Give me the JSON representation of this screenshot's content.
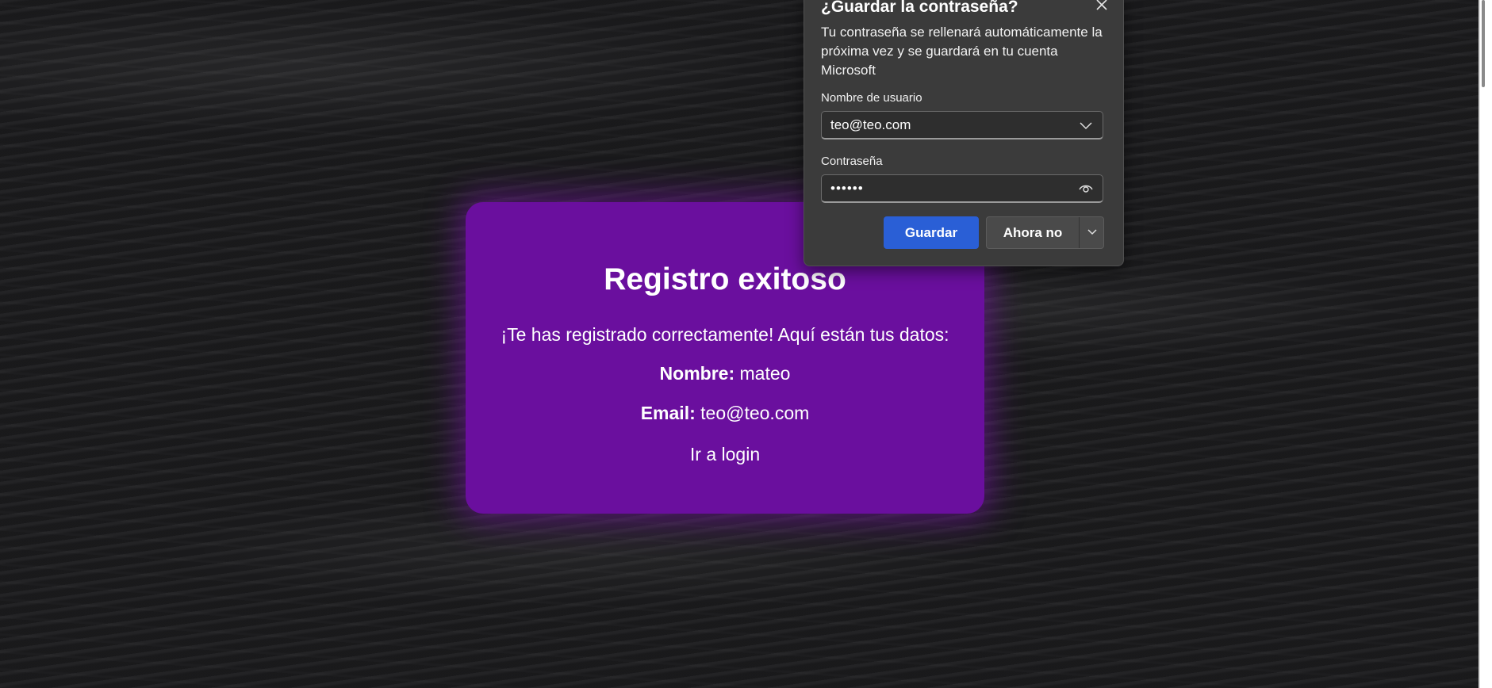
{
  "card": {
    "title": "Registro exitoso",
    "message": "¡Te has registrado correctamente! Aquí están tus datos:",
    "name_label": "Nombre:",
    "name_value": "mateo",
    "email_label": "Email:",
    "email_value": "teo@teo.com",
    "login_link": "Ir a login",
    "background_color": "#6a0f9e"
  },
  "password_popup": {
    "title": "¿Guardar la contraseña?",
    "description": "Tu contraseña se rellenará automáticamente la próxima vez y se guardará en tu cuenta Microsoft",
    "username_label": "Nombre de usuario",
    "username_value": "teo@teo.com",
    "password_label": "Contraseña",
    "password_value": "••••••",
    "save_button": "Guardar",
    "not_now_button": "Ahora no",
    "accent_color": "#2a5fd6",
    "icons": [
      "close-icon",
      "chevron-down-icon",
      "eye-icon"
    ]
  }
}
